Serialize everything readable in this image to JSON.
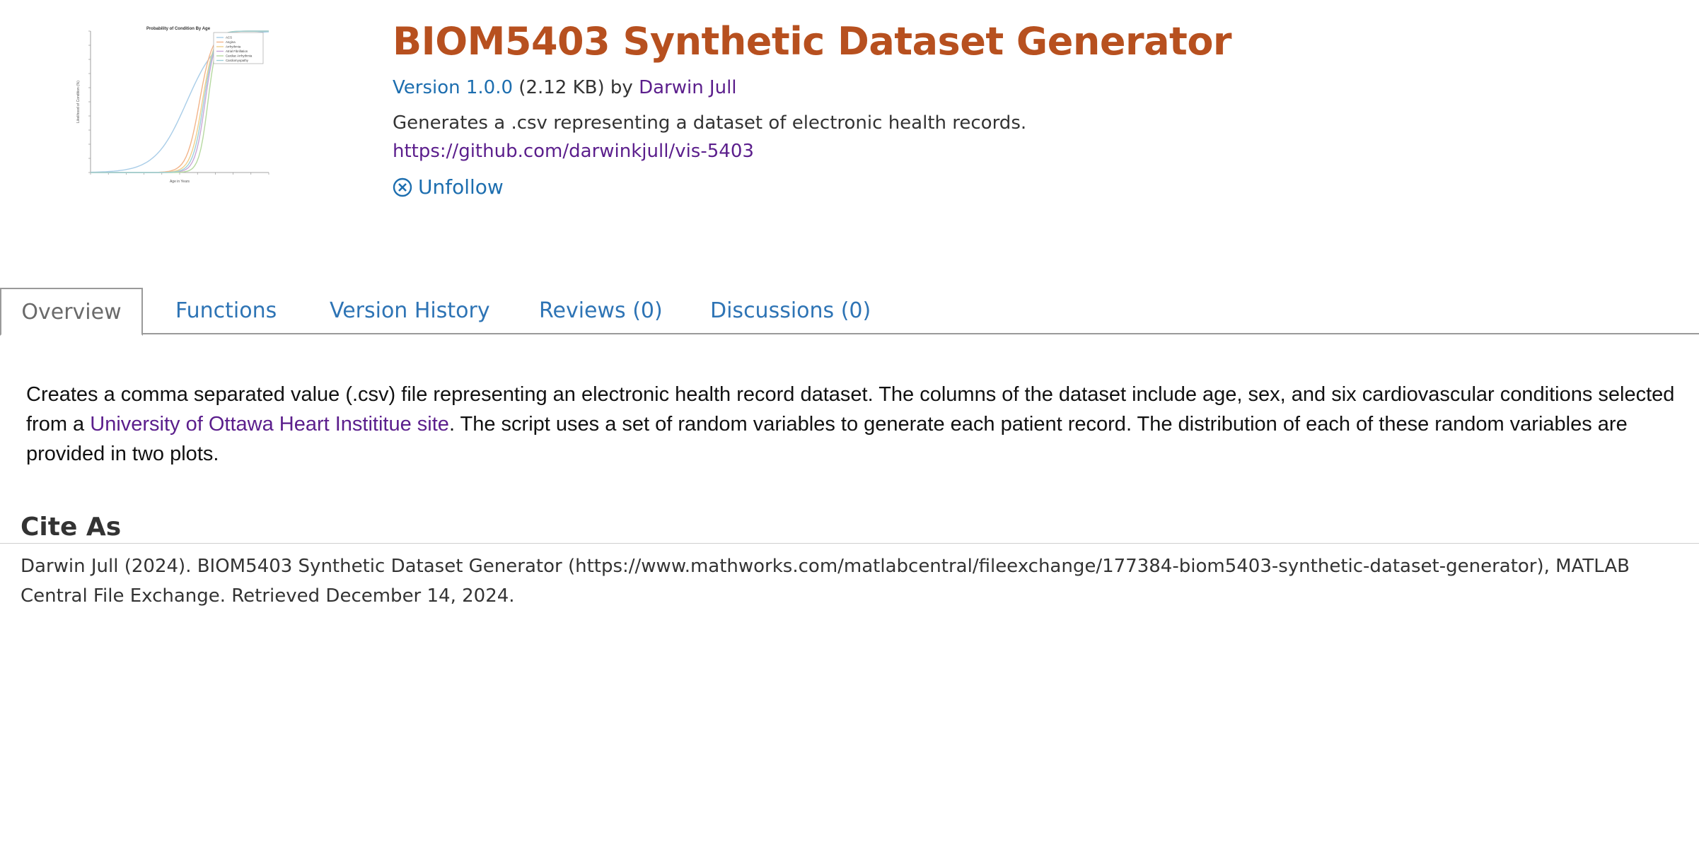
{
  "thumbnail": {
    "title": "Probability of Condition By Age",
    "xlabel": "Age in Years",
    "ylabel": "Likelihood of Condition (%)",
    "legend": [
      "ACS",
      "Angina",
      "Arrhythmia",
      "Atrial Fibrillation",
      "Cardiac Arrhythmia",
      "Cardiomyopathy"
    ],
    "colors": [
      "#a9cde8",
      "#f2b48a",
      "#f0d08c",
      "#c9a7d8",
      "#b6d9a0",
      "#9ed0d8"
    ]
  },
  "header": {
    "title": "BIOM5403 Synthetic Dataset Generator",
    "version_link": "Version 1.0.0",
    "size": "(2.12 KB)",
    "by": "by",
    "author": "Darwin Jull",
    "summary": "Generates a .csv representing a dataset of electronic health records.",
    "repo_url": "https://github.com/darwinkjull/vis-5403",
    "unfollow_label": "Unfollow"
  },
  "tabs": [
    {
      "label": "Overview",
      "active": true
    },
    {
      "label": "Functions",
      "active": false
    },
    {
      "label": "Version History",
      "active": false
    },
    {
      "label": "Reviews (0)",
      "active": false
    },
    {
      "label": "Discussions (0)",
      "active": false
    }
  ],
  "overview": {
    "text_part1": "Creates a comma separated value (.csv) file representing an electronic health record dataset. The columns of the dataset include age, sex, and six cardiovascular conditions selected from a ",
    "link_text": "University of Ottawa Heart Instititue site",
    "text_part2": ". The script uses a set of random variables to generate each patient record. The distribution of each of these random variables are provided in two plots."
  },
  "cite": {
    "heading": "Cite As",
    "text": "Darwin Jull (2024). BIOM5403 Synthetic Dataset Generator (https://www.mathworks.com/matlabcentral/fileexchange/177384-biom5403-synthetic-dataset-generator), MATLAB Central File Exchange. Retrieved December 14, 2024."
  },
  "colors": {
    "title": "#b7501f",
    "link_blue": "#1d6eaf",
    "link_purple": "#5b1e8c",
    "tab_text": "#2e74b5"
  }
}
